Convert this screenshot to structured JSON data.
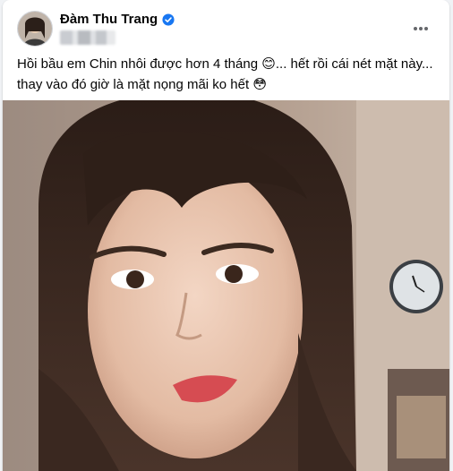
{
  "post": {
    "author": "Đàm Thu Trang",
    "text_line_1": "Hồi bầu em Chin nhôi được hơn 4 tháng",
    "emoji_1": "😊",
    "text_line_1_tail": "... hết rồi cái nét mặt này...",
    "text_line_2": "thay vào đó giờ là mặt nọng mãi ko hết",
    "emoji_2": "😳",
    "more_label": "•••"
  },
  "colors": {
    "verified": "#1877f2",
    "card_bg": "#ffffff",
    "page_bg": "#f0f2f5",
    "text": "#050505",
    "secondary": "#65676b"
  },
  "icons": {
    "verified": "verified-badge-icon",
    "more": "more-options-icon",
    "avatar": "profile-avatar"
  }
}
